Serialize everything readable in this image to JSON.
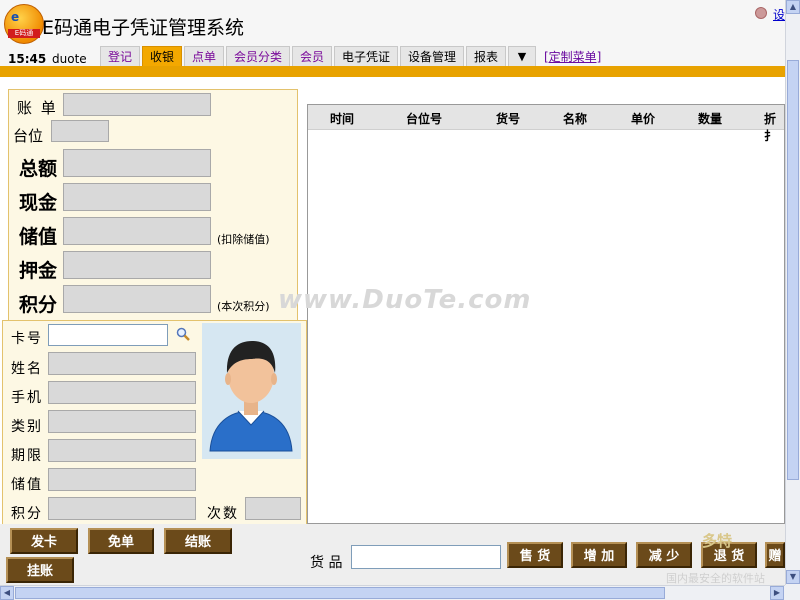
{
  "header": {
    "app_title": "E码通电子凭证管理系统",
    "logo_text_top": "e",
    "logo_text_bottom": "E码通",
    "settings_label": "设",
    "clock": "15:45",
    "user": "duote",
    "custom_menu_label": "[定制菜单]"
  },
  "tabs": [
    {
      "label": "登记"
    },
    {
      "label": "收银"
    },
    {
      "label": "点单"
    },
    {
      "label": "会员分类"
    },
    {
      "label": "会员"
    },
    {
      "label": "电子凭证"
    },
    {
      "label": "设备管理"
    },
    {
      "label": "报表"
    },
    {
      "label": "▼"
    }
  ],
  "active_tab": "收银",
  "bill_form": {
    "bill_label": "账 单",
    "table_label": "台位",
    "total_label": "总额",
    "cash_label": "现金",
    "stored_value_label": "储值",
    "stored_value_note": "(扣除储值)",
    "deposit_label": "押金",
    "points_label": "积分",
    "points_note": "(本次积分)"
  },
  "member_form": {
    "card_label": "卡号",
    "name_label": "姓名",
    "phone_label": "手机",
    "category_label": "类别",
    "expiry_label": "期限",
    "stored_label": "储值",
    "points_label": "积分",
    "count_label": "次数",
    "card_value": ""
  },
  "grid": {
    "columns": [
      "时间",
      "台位号",
      "货号",
      "名称",
      "单价",
      "数量",
      "折扌"
    ]
  },
  "bottom_buttons": {
    "issue_card": "发卡",
    "free_bill": "免单",
    "settle": "结账",
    "hang_bill": "挂账",
    "sell": "售 货",
    "add": "增 加",
    "reduce": "减 少",
    "return_goods": "退 货",
    "more": "赠"
  },
  "goods": {
    "label": "货 品",
    "value": ""
  },
  "watermarks": {
    "center": "www.DuoTe.com",
    "corner_top": "多特",
    "corner_bottom": "国内最安全的软件站"
  },
  "colors": {
    "accent_orange": "#e8a200",
    "active_tab": "#f3a800",
    "button_brown": "#6b4a1a",
    "panel_bg": "#fdf8e4",
    "tab_purple": "#7a0a9a"
  }
}
